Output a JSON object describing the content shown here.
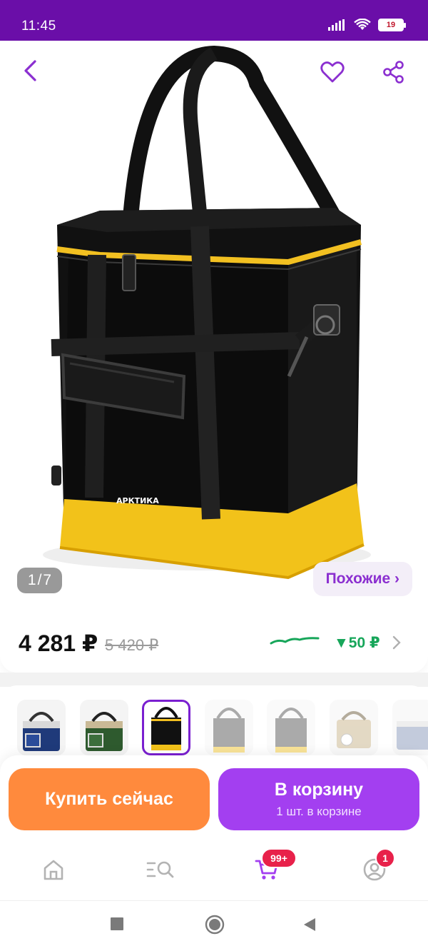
{
  "status_bar": {
    "time": "11:45",
    "battery": "19"
  },
  "gallery": {
    "counter_current": "1",
    "counter_sep": "/",
    "counter_total": "7",
    "similar_label": "Похожие ›",
    "brand_print": "АРКТИКА"
  },
  "price": {
    "current": "4 281 ₽",
    "old": "5 420 ₽",
    "drop": "▼50 ₽"
  },
  "actions": {
    "buy_now": "Купить сейчас",
    "to_cart": "В корзину",
    "in_cart": "1 шт. в корзине"
  },
  "nav": {
    "cart_badge": "99+",
    "profile_badge": "1"
  },
  "colors": {
    "brand_purple": "#6a0ea8",
    "accent_purple": "#a33ff0",
    "orange": "#ff8a3d",
    "green": "#17a65a",
    "badge_red": "#e8214a"
  },
  "icons": [
    "back-icon",
    "heart-icon",
    "share-icon",
    "home-icon",
    "catalog-search-icon",
    "cart-icon",
    "profile-icon",
    "stop-icon",
    "home-circle-icon",
    "back-triangle-icon"
  ]
}
